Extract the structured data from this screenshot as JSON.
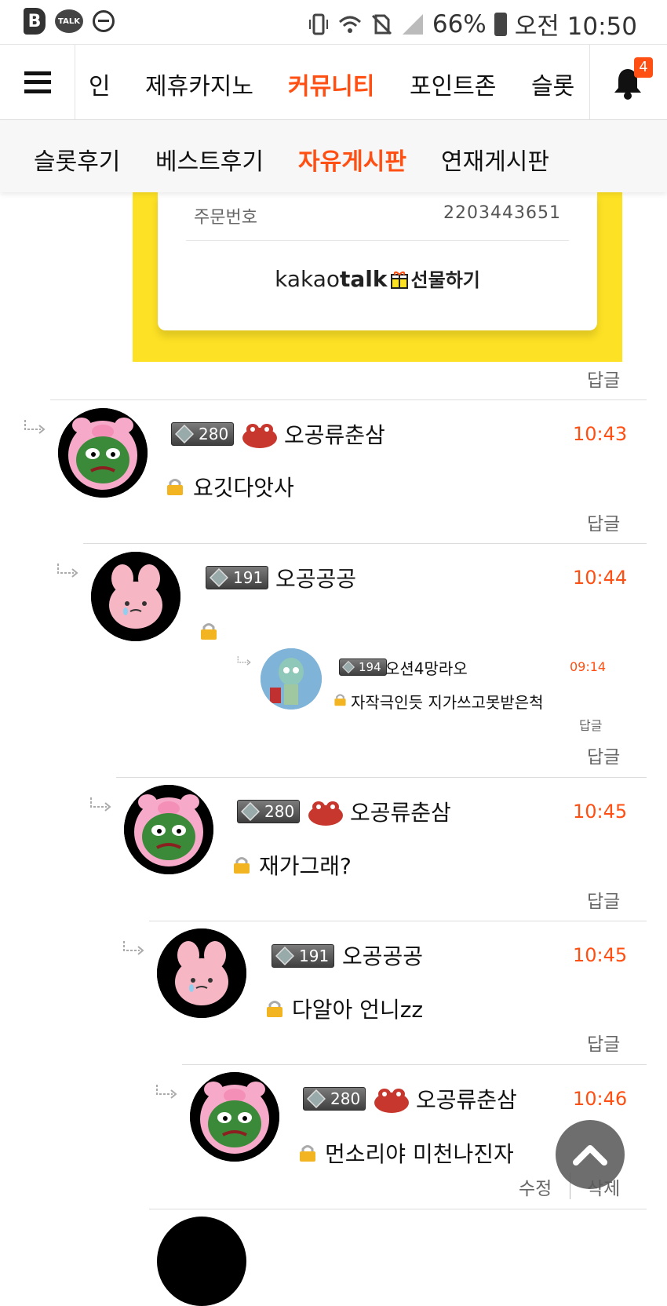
{
  "status_bar": {
    "battery": "66%",
    "time": "오전 10:50",
    "talk_label": "TALK"
  },
  "nav": {
    "items": [
      "인",
      "제휴카지노",
      "커뮤니티",
      "포인트존",
      "슬롯"
    ],
    "active_index": 2,
    "notification_count": "4"
  },
  "subnav": {
    "items": [
      "슬롯후기",
      "베스트후기",
      "자유게시판",
      "연재게시판"
    ],
    "active_index": 2
  },
  "gift_card": {
    "order_label": "주문번호",
    "order_number": "2203443651",
    "brand_kakao": "kakao",
    "brand_talk": "talk",
    "brand_gift": "선물하기"
  },
  "reply_label": "답글",
  "comments": [
    {
      "level": "280",
      "nick": "오공류춘삼",
      "time": "10:43",
      "text": "요깃다앗사"
    },
    {
      "level": "191",
      "nick": "오공공공",
      "time": "10:44",
      "text": ""
    },
    {
      "level": "194",
      "nick": "오션4망라오",
      "time": "09:14",
      "text": "자작극인듯 지가쓰고못받은척"
    },
    {
      "level": "280",
      "nick": "오공류춘삼",
      "time": "10:45",
      "text": "재가그래?"
    },
    {
      "level": "191",
      "nick": "오공공공",
      "time": "10:45",
      "text": "다알아 언니zz"
    },
    {
      "level": "280",
      "nick": "오공류춘삼",
      "time": "10:46",
      "text": "먼소리야 미천나진자"
    }
  ],
  "actions": {
    "edit": "수정",
    "delete": "삭제"
  }
}
